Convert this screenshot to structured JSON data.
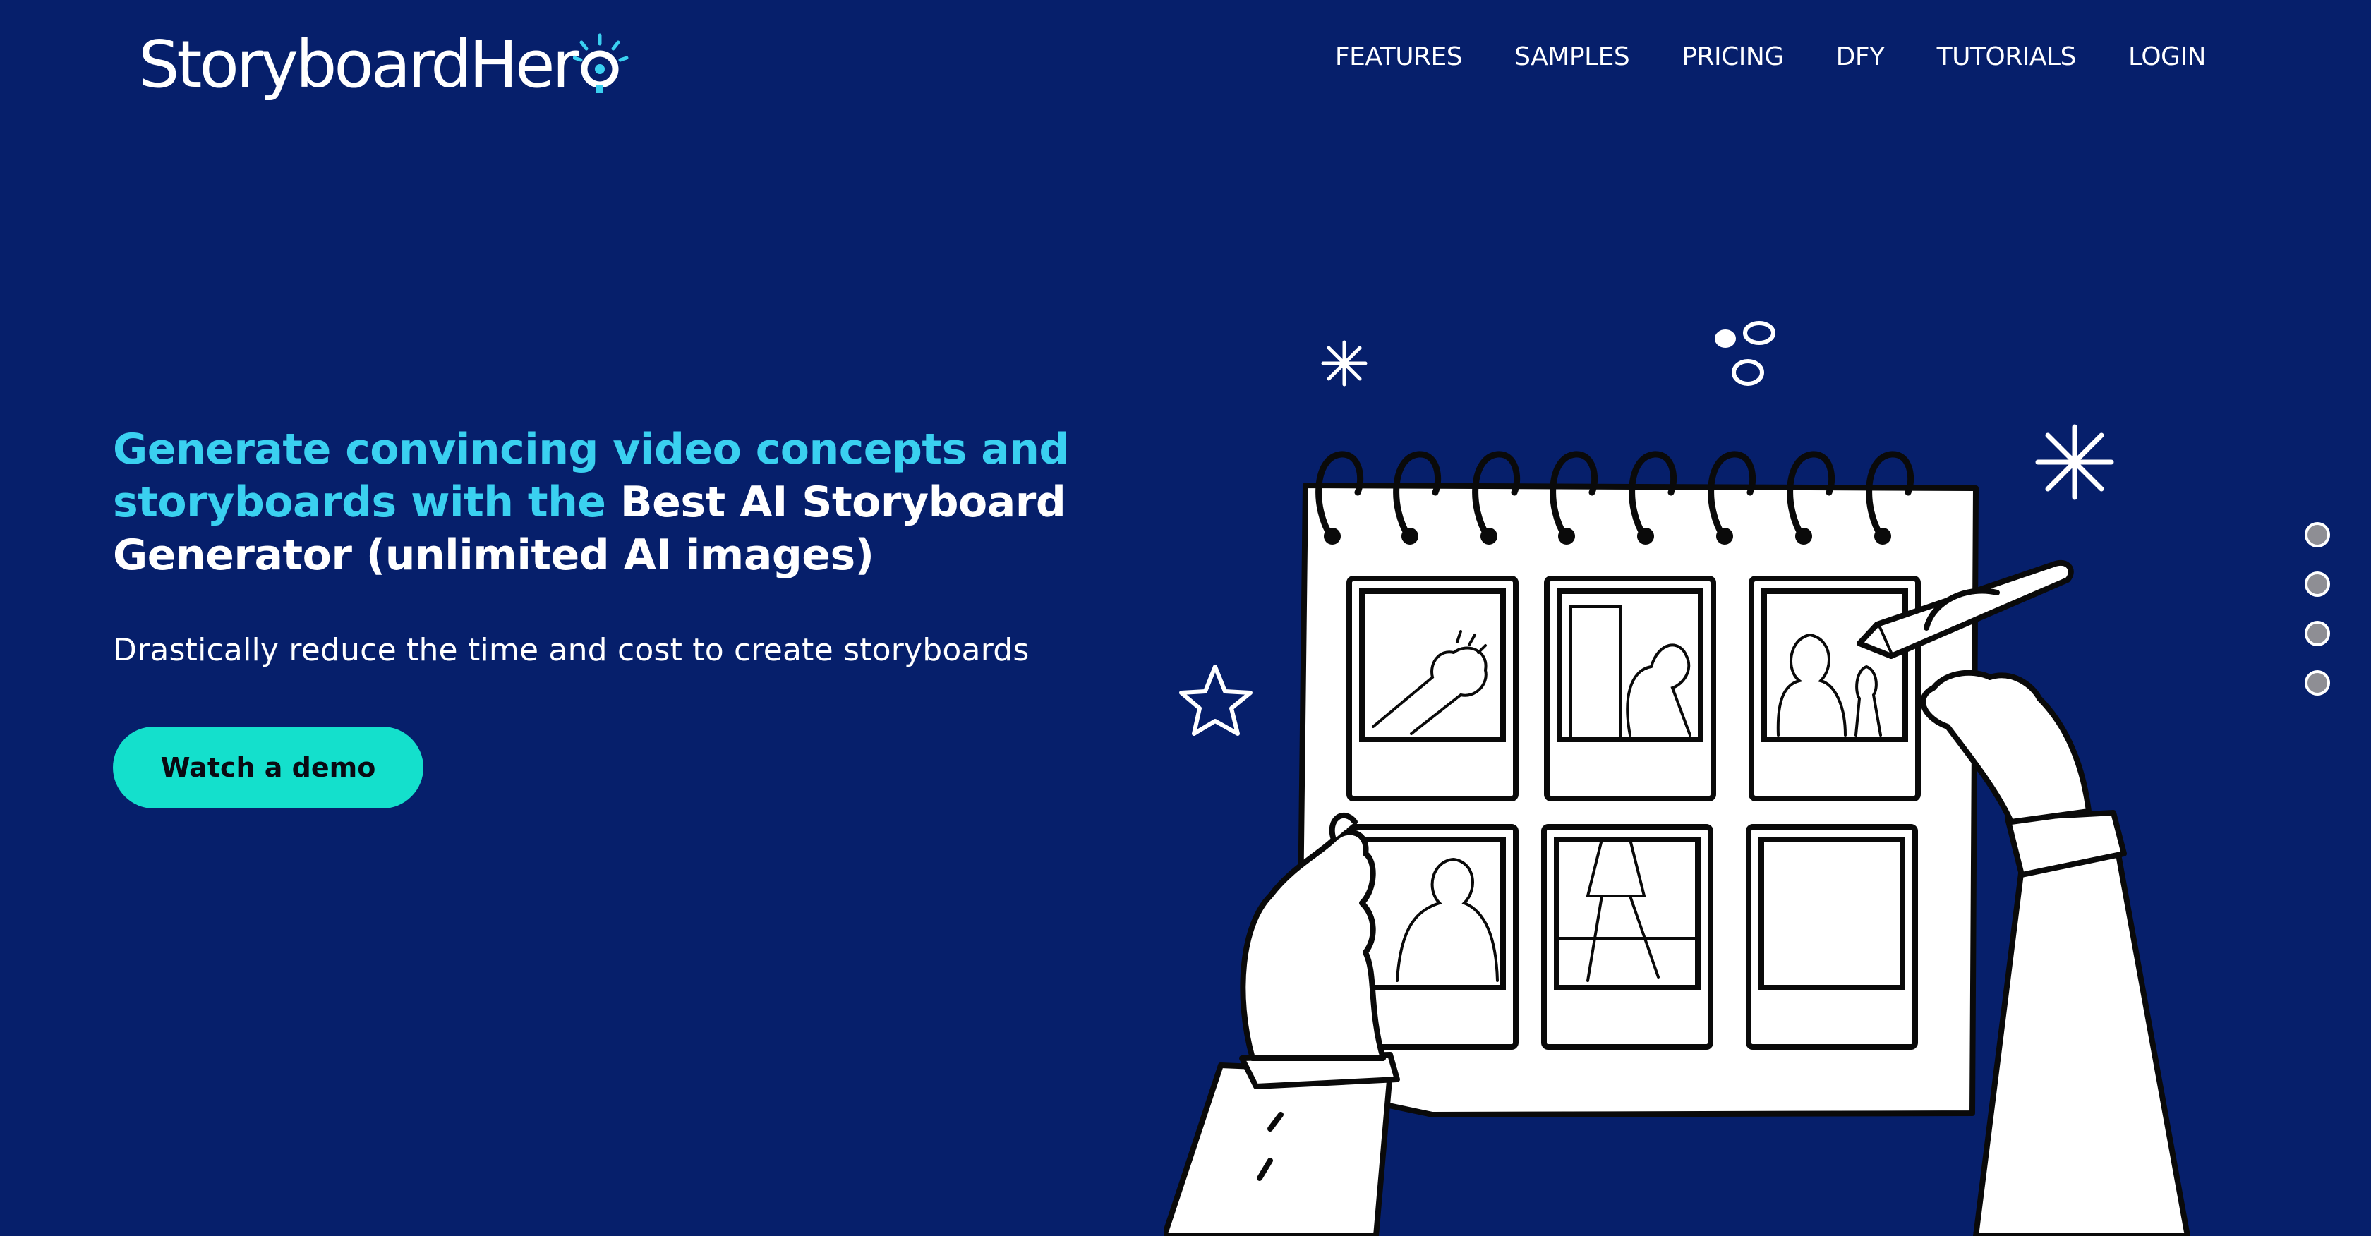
{
  "brand": {
    "logo_text": "Storyboard",
    "logo_text_2": "Her",
    "logo_alt": "StoryboardHero"
  },
  "nav": {
    "items": [
      {
        "label": "FEATURES"
      },
      {
        "label": "SAMPLES"
      },
      {
        "label": "PRICING"
      },
      {
        "label": "DFY"
      },
      {
        "label": "TUTORIALS"
      },
      {
        "label": "LOGIN"
      }
    ]
  },
  "hero": {
    "headline_accent": "Generate convincing video concepts and storyboards with the",
    "headline_strong": "Best AI Storyboard Generator (unlimited AI images)",
    "subheadline": "Drastically reduce the time and cost to create storyboards",
    "cta_label": "Watch a demo"
  },
  "slider": {
    "dot_count": 4,
    "active_index": 0
  },
  "colors": {
    "background": "#061f6b",
    "accent_text": "#3ad0f0",
    "cta_bg": "#14e0cc",
    "text": "#ffffff"
  },
  "icons": {
    "logo": "lightbulb-icon",
    "illustration": "storyboard-sketchbook-illustration"
  }
}
